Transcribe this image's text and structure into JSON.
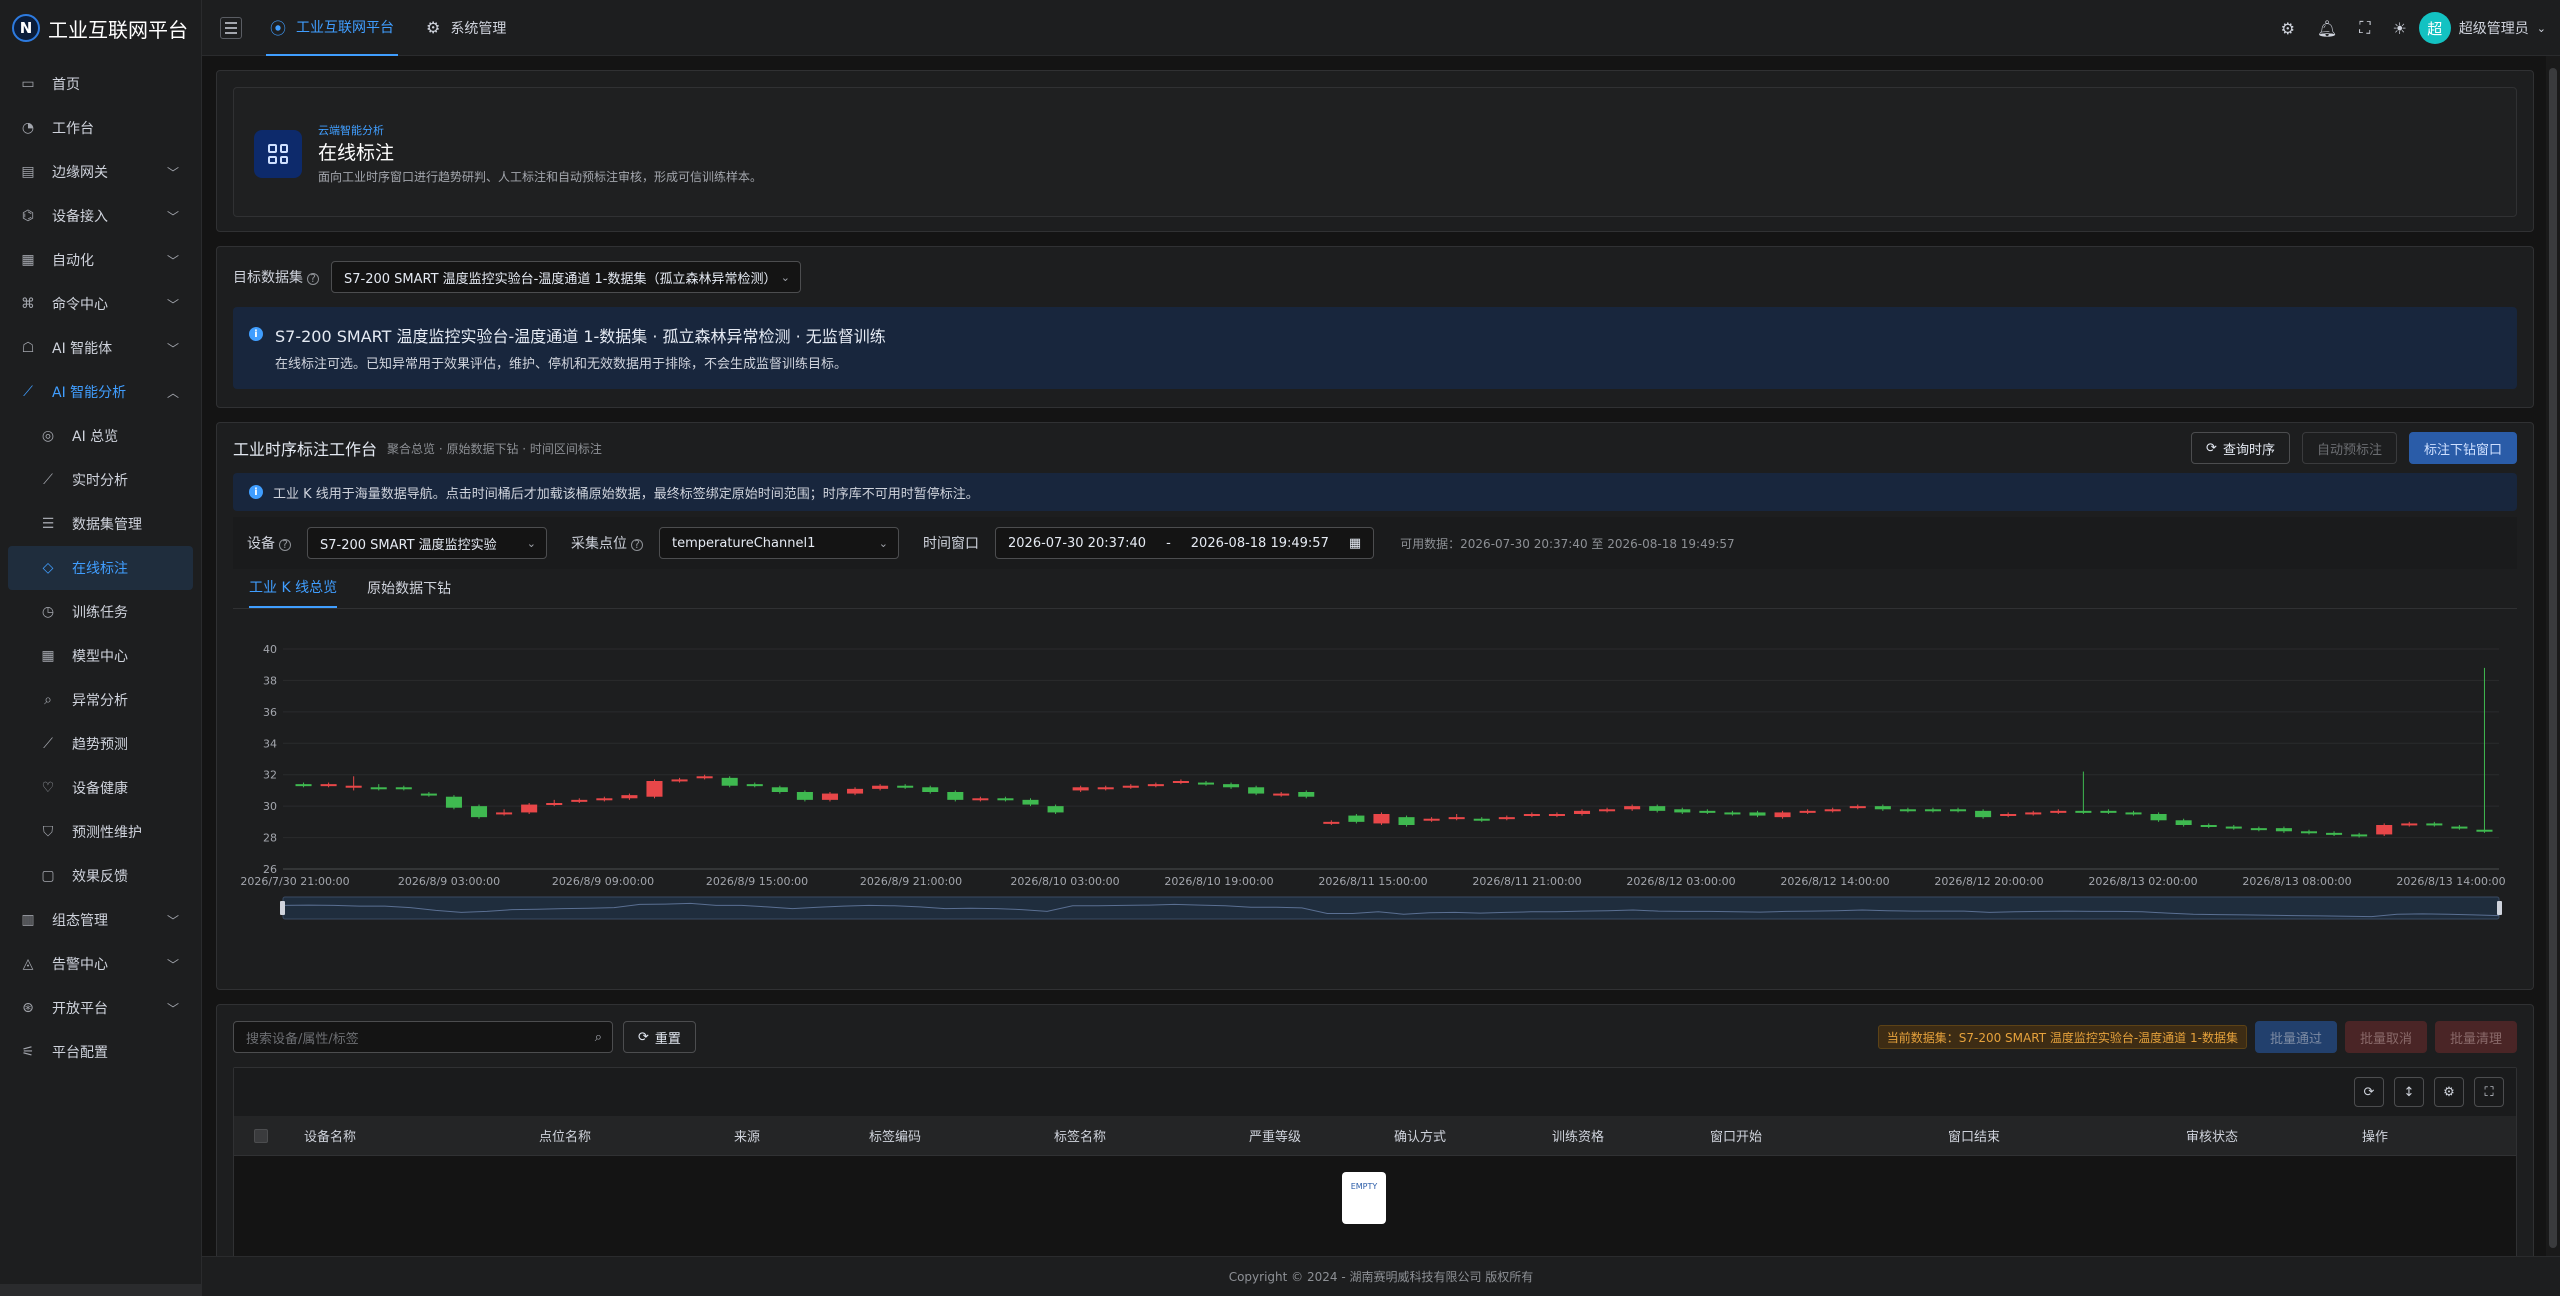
{
  "brand": {
    "title": "工业互联网平台",
    "logo_letter": "N"
  },
  "sidebar": {
    "items": [
      {
        "label": "首页",
        "icon": "monitor-icon"
      },
      {
        "label": "工作台",
        "icon": "dashboard-icon"
      },
      {
        "label": "边缘网关",
        "icon": "gateway-icon",
        "expandable": true
      },
      {
        "label": "设备接入",
        "icon": "device-icon",
        "expandable": true
      },
      {
        "label": "自动化",
        "icon": "automation-icon",
        "expandable": true
      },
      {
        "label": "命令中心",
        "icon": "command-icon",
        "expandable": true
      },
      {
        "label": "AI 智能体",
        "icon": "robot-icon",
        "expandable": true
      },
      {
        "label": "AI 智能分析",
        "icon": "chart-icon",
        "expandable": true,
        "open": true
      }
    ],
    "subitems": [
      {
        "label": "AI 总览",
        "icon": "ai-icon"
      },
      {
        "label": "实时分析",
        "icon": "line-chart-icon"
      },
      {
        "label": "数据集管理",
        "icon": "dataset-icon"
      },
      {
        "label": "在线标注",
        "icon": "tag-icon",
        "active": true
      },
      {
        "label": "训练任务",
        "icon": "clock-icon"
      },
      {
        "label": "模型中心",
        "icon": "grid-icon"
      },
      {
        "label": "异常分析",
        "icon": "search-icon"
      },
      {
        "label": "趋势预测",
        "icon": "trend-icon"
      },
      {
        "label": "设备健康",
        "icon": "heart-icon"
      },
      {
        "label": "预测性维护",
        "icon": "shield-icon"
      },
      {
        "label": "效果反馈",
        "icon": "feedback-icon"
      }
    ],
    "items_after": [
      {
        "label": "组态管理",
        "icon": "layout-icon",
        "expandable": true
      },
      {
        "label": "告警中心",
        "icon": "alarm-icon",
        "expandable": true
      },
      {
        "label": "开放平台",
        "icon": "open-icon",
        "expandable": true
      },
      {
        "label": "平台配置",
        "icon": "settings-icon"
      }
    ]
  },
  "header": {
    "tabs": [
      {
        "label": "工业互联网平台",
        "active": true
      },
      {
        "label": "系统管理",
        "active": false
      }
    ],
    "user_name": "超级管理员",
    "avatar_letter": "超"
  },
  "page": {
    "eyebrow": "云端智能分析",
    "title": "在线标注",
    "description": "面向工业时序窗口进行趋势研判、人工标注和自动预标注审核，形成可信训练样本。"
  },
  "dataset": {
    "label": "目标数据集",
    "selected": "S7-200 SMART 温度监控实验台-温度通道 1-数据集（孤立森林异常检测）",
    "alert_title": "S7-200 SMART 温度监控实验台-温度通道 1-数据集 · 孤立森林异常检测 · 无监督训练",
    "alert_desc": "在线标注可选。已知异常用于效果评估，维护、停机和无效数据用于排除，不会生成监督训练目标。"
  },
  "workspace": {
    "title": "工业时序标注工作台",
    "subtitle": "聚合总览 · 原始数据下钻 · 时间区间标注",
    "btn_query": "查询时序",
    "btn_auto": "自动预标注",
    "btn_drill": "标注下钻窗口",
    "info": "工业 K 线用于海量数据导航。点击时间桶后才加载该桶原始数据，最终标签绑定原始时间范围；时序库不可用时暂停标注。",
    "device_label": "设备",
    "device_value": "S7-200 SMART 温度监控实验",
    "point_label": "采集点位",
    "point_value": "temperatureChannel1",
    "window_label": "时间窗口",
    "window_start": "2026-07-30 20:37:40",
    "window_sep": "-",
    "window_end": "2026-08-18 19:49:57",
    "available": "可用数据：2026-07-30 20:37:40 至 2026-08-18 19:49:57",
    "tab_kline": "工业 K 线总览",
    "tab_raw": "原始数据下钻"
  },
  "chart_data": {
    "type": "candlestick",
    "ylim": [
      26,
      40
    ],
    "yticks": [
      26,
      28,
      30,
      32,
      34,
      36,
      38,
      40
    ],
    "xticks": [
      "2026/7/30 21:00:00",
      "2026/8/9 03:00:00",
      "2026/8/9 09:00:00",
      "2026/8/9 15:00:00",
      "2026/8/9 21:00:00",
      "2026/8/10 03:00:00",
      "2026/8/10 19:00:00",
      "2026/8/11 15:00:00",
      "2026/8/11 21:00:00",
      "2026/8/12 03:00:00",
      "2026/8/12 14:00:00",
      "2026/8/12 20:00:00",
      "2026/8/13 02:00:00",
      "2026/8/13 08:00:00",
      "2026/8/13 14:00:00"
    ],
    "up_color": "#e84749",
    "down_color": "#3fb950",
    "candles": [
      [
        31.4,
        31.3,
        31.5,
        31.2
      ],
      [
        31.3,
        31.4,
        31.5,
        31.2
      ],
      [
        31.2,
        31.3,
        31.9,
        31.0
      ],
      [
        31.2,
        31.1,
        31.4,
        31.0
      ],
      [
        31.2,
        31.1,
        31.3,
        31.0
      ],
      [
        30.8,
        30.7,
        30.9,
        30.6
      ],
      [
        30.6,
        29.9,
        30.7,
        29.8
      ],
      [
        30.0,
        29.3,
        30.1,
        29.2
      ],
      [
        29.5,
        29.6,
        29.8,
        29.4
      ],
      [
        29.6,
        30.1,
        30.2,
        29.5
      ],
      [
        30.1,
        30.2,
        30.4,
        30.0
      ],
      [
        30.3,
        30.4,
        30.5,
        30.2
      ],
      [
        30.4,
        30.5,
        30.6,
        30.3
      ],
      [
        30.5,
        30.7,
        30.8,
        30.4
      ],
      [
        30.6,
        31.6,
        31.7,
        30.5
      ],
      [
        31.6,
        31.7,
        31.8,
        31.5
      ],
      [
        31.8,
        31.9,
        32.0,
        31.7
      ],
      [
        31.8,
        31.3,
        31.9,
        31.2
      ],
      [
        31.4,
        31.3,
        31.5,
        31.2
      ],
      [
        31.2,
        30.9,
        31.3,
        30.8
      ],
      [
        30.9,
        30.4,
        31.0,
        30.3
      ],
      [
        30.4,
        30.8,
        30.9,
        30.3
      ],
      [
        30.8,
        31.1,
        31.2,
        30.7
      ],
      [
        31.1,
        31.3,
        31.4,
        31.0
      ],
      [
        31.3,
        31.2,
        31.4,
        31.1
      ],
      [
        31.2,
        30.9,
        31.3,
        30.8
      ],
      [
        30.9,
        30.4,
        31.0,
        30.3
      ],
      [
        30.4,
        30.5,
        30.6,
        30.3
      ],
      [
        30.5,
        30.4,
        30.6,
        30.3
      ],
      [
        30.4,
        30.1,
        30.5,
        30.0
      ],
      [
        30.0,
        29.6,
        30.1,
        29.5
      ],
      [
        31.0,
        31.2,
        31.3,
        30.9
      ],
      [
        31.1,
        31.2,
        31.3,
        31.0
      ],
      [
        31.2,
        31.3,
        31.4,
        31.1
      ],
      [
        31.3,
        31.4,
        31.5,
        31.2
      ],
      [
        31.5,
        31.6,
        31.7,
        31.4
      ],
      [
        31.5,
        31.4,
        31.6,
        31.3
      ],
      [
        31.4,
        31.2,
        31.5,
        31.1
      ],
      [
        31.2,
        30.8,
        31.3,
        30.7
      ],
      [
        30.7,
        30.8,
        30.9,
        30.6
      ],
      [
        30.9,
        30.6,
        31.0,
        30.5
      ],
      [
        28.9,
        29.0,
        29.1,
        28.8
      ],
      [
        29.4,
        29.0,
        29.5,
        28.9
      ],
      [
        28.9,
        29.5,
        29.6,
        28.8
      ],
      [
        29.3,
        28.8,
        29.4,
        28.7
      ],
      [
        29.1,
        29.2,
        29.3,
        29.0
      ],
      [
        29.2,
        29.3,
        29.5,
        29.1
      ],
      [
        29.2,
        29.1,
        29.3,
        29.0
      ],
      [
        29.2,
        29.3,
        29.4,
        29.1
      ],
      [
        29.4,
        29.5,
        29.6,
        29.3
      ],
      [
        29.4,
        29.5,
        29.6,
        29.3
      ],
      [
        29.5,
        29.7,
        29.8,
        29.4
      ],
      [
        29.7,
        29.8,
        29.9,
        29.6
      ],
      [
        29.8,
        30.0,
        30.1,
        29.7
      ],
      [
        30.0,
        29.7,
        30.1,
        29.6
      ],
      [
        29.8,
        29.6,
        29.9,
        29.5
      ],
      [
        29.7,
        29.6,
        29.8,
        29.5
      ],
      [
        29.6,
        29.5,
        29.7,
        29.4
      ],
      [
        29.6,
        29.4,
        29.7,
        29.3
      ],
      [
        29.3,
        29.6,
        29.7,
        29.2
      ],
      [
        29.6,
        29.7,
        29.8,
        29.5
      ],
      [
        29.7,
        29.8,
        29.9,
        29.6
      ],
      [
        29.9,
        30.0,
        30.1,
        29.8
      ],
      [
        30.0,
        29.8,
        30.1,
        29.7
      ],
      [
        29.8,
        29.7,
        29.9,
        29.6
      ],
      [
        29.8,
        29.7,
        29.9,
        29.6
      ],
      [
        29.8,
        29.7,
        29.9,
        29.6
      ],
      [
        29.7,
        29.3,
        29.8,
        29.2
      ],
      [
        29.4,
        29.5,
        29.6,
        29.3
      ],
      [
        29.5,
        29.6,
        29.7,
        29.4
      ],
      [
        29.6,
        29.7,
        29.8,
        29.5
      ],
      [
        29.7,
        29.6,
        32.2,
        29.5
      ],
      [
        29.7,
        29.6,
        29.8,
        29.5
      ],
      [
        29.6,
        29.5,
        29.7,
        29.4
      ],
      [
        29.5,
        29.1,
        29.6,
        29.0
      ],
      [
        29.1,
        28.8,
        29.2,
        28.7
      ],
      [
        28.8,
        28.7,
        28.9,
        28.6
      ],
      [
        28.7,
        28.6,
        28.8,
        28.5
      ],
      [
        28.6,
        28.5,
        28.7,
        28.4
      ],
      [
        28.6,
        28.4,
        28.7,
        28.3
      ],
      [
        28.4,
        28.3,
        28.5,
        28.2
      ],
      [
        28.3,
        28.2,
        28.4,
        28.1
      ],
      [
        28.2,
        28.1,
        28.3,
        28.0
      ],
      [
        28.2,
        28.8,
        28.9,
        28.1
      ],
      [
        28.8,
        28.9,
        29.0,
        28.7
      ],
      [
        28.9,
        28.8,
        29.0,
        28.7
      ],
      [
        28.7,
        28.6,
        28.8,
        28.5
      ],
      [
        28.5,
        28.4,
        38.8,
        28.3
      ]
    ]
  },
  "table": {
    "search_placeholder": "搜索设备/属性/标签",
    "reset_label": "重置",
    "current_tag": "当前数据集：S7-200 SMART 温度监控实验台-温度通道 1-数据集",
    "btn_approve": "批量通过",
    "btn_cancel": "批量取消",
    "btn_clear": "批量清理",
    "columns": [
      "设备名称",
      "点位名称",
      "来源",
      "标签编码",
      "标签名称",
      "严重等级",
      "确认方式",
      "训练资格",
      "窗口开始",
      "窗口结束",
      "审核状态",
      "操作"
    ],
    "empty_text": "EMPTY"
  },
  "footer": {
    "text": "Copyright © 2024 - 湖南赛明威科技有限公司 版权所有"
  }
}
